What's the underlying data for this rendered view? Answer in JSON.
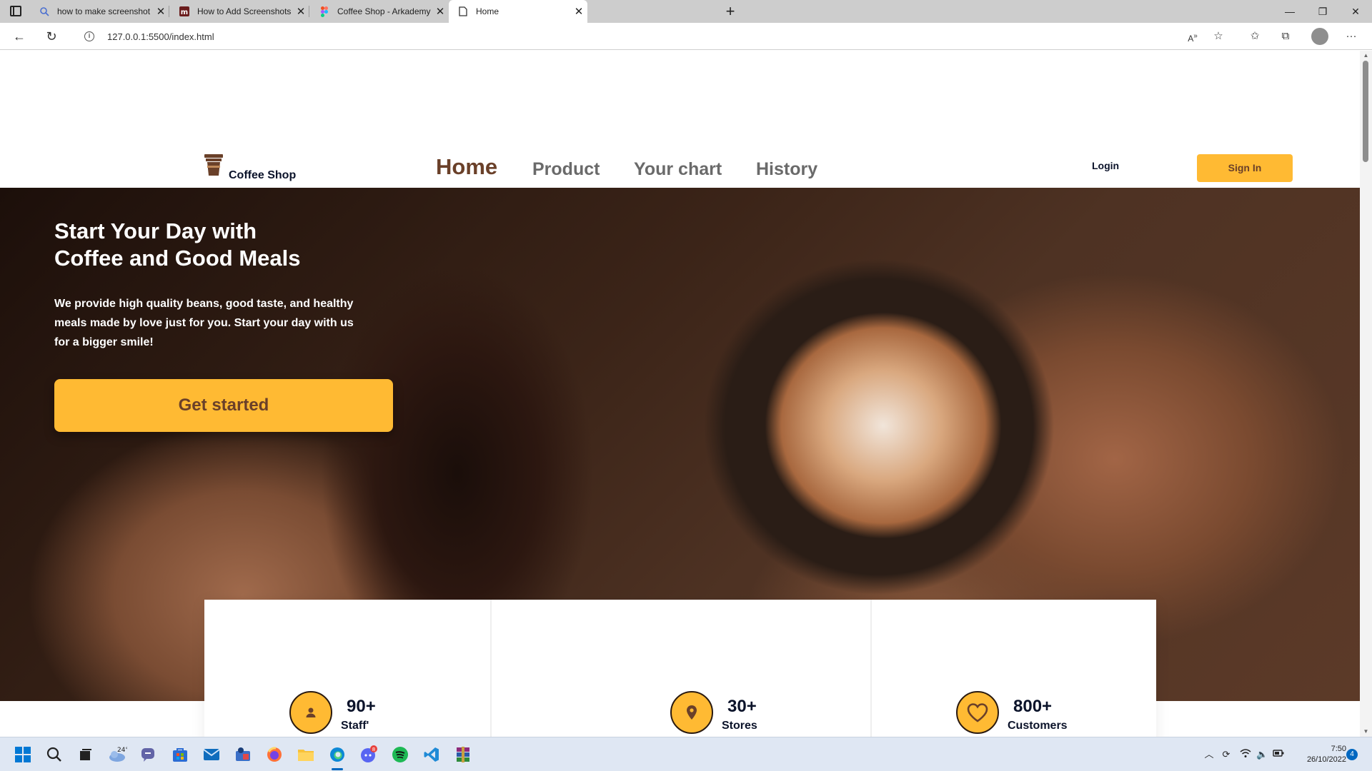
{
  "browser": {
    "tabs": [
      {
        "title": "how to make screenshot in repo",
        "icon": "search-icon"
      },
      {
        "title": "How to Add Screenshots and An",
        "icon": "m-logo-icon"
      },
      {
        "title": "Coffee Shop - Arkademy – Figma",
        "icon": "figma-icon"
      },
      {
        "title": "Home",
        "icon": "page-icon"
      }
    ],
    "url": "127.0.0.1:5500/index.html"
  },
  "site": {
    "logo_text": "Coffee Shop",
    "nav": {
      "home": "Home",
      "product": "Product",
      "chart": "Your chart",
      "history": "History"
    },
    "login": "Login",
    "signin": "Sign In"
  },
  "hero": {
    "title_line1": "Start Your Day with",
    "title_line2": "Coffee and Good Meals",
    "desc_line1": "We provide high quality beans, good taste, and healthy",
    "desc_line2": "meals made by love just for you. Start your day with us",
    "desc_line3": "for a bigger smile!",
    "cta": "Get started"
  },
  "stats": [
    {
      "value": "90+",
      "label": "Staff'",
      "icon": "user-icon"
    },
    {
      "value": "30+",
      "label": "Stores",
      "icon": "location-pin-icon"
    },
    {
      "value": "800+",
      "label": "Customers",
      "icon": "heart-icon"
    }
  ],
  "taskbar": {
    "weather_temp": "24°",
    "discord_badge": "8",
    "time": "7:50",
    "date": "26/10/2022",
    "notifications": "4"
  },
  "colors": {
    "accent": "#ffba33",
    "brand_brown": "#6a4029",
    "dark_text": "#0b132a"
  }
}
